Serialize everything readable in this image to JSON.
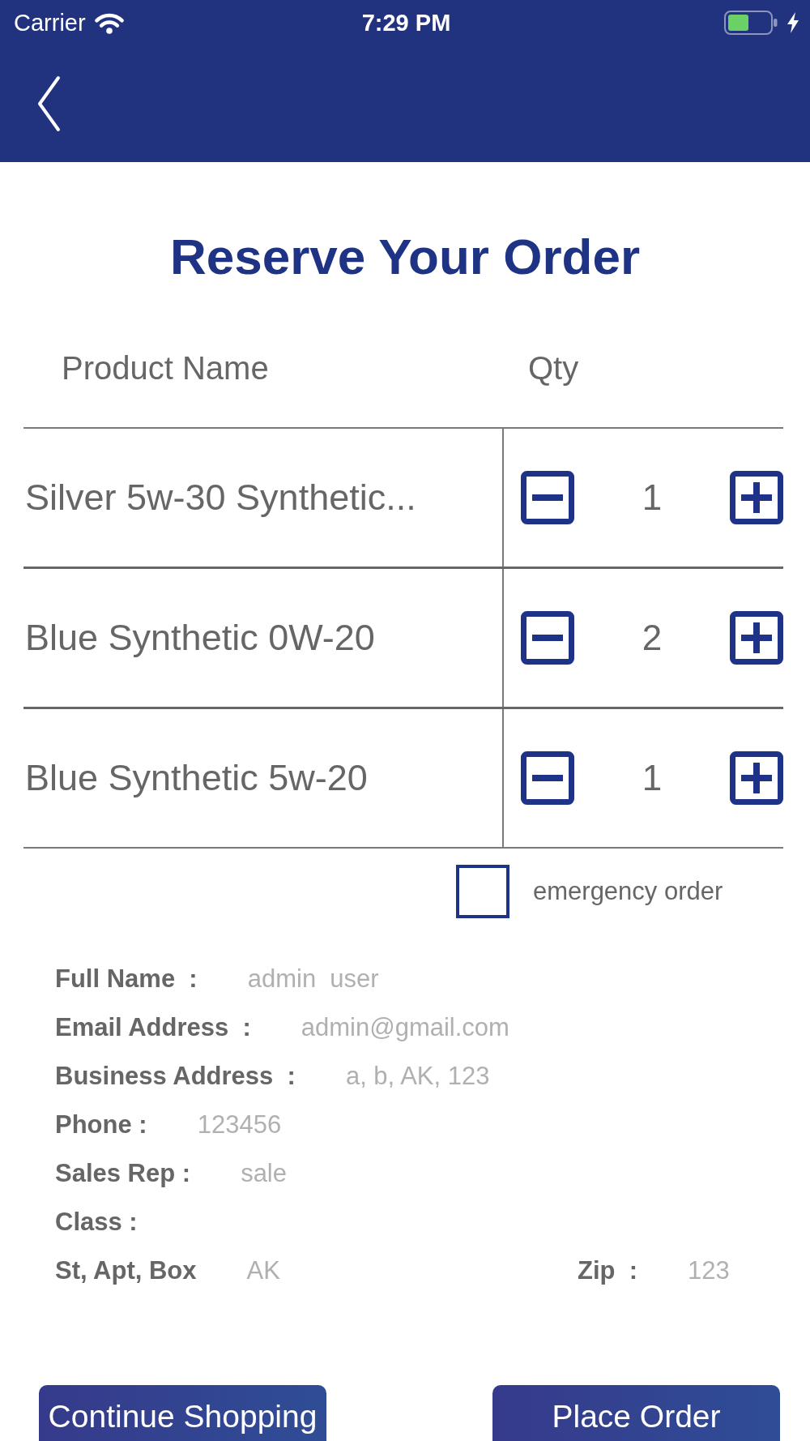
{
  "status_bar": {
    "carrier": "Carrier",
    "time": "7:29 PM"
  },
  "title": "Reserve Your Order",
  "table": {
    "columns": [
      "Product Name",
      "Qty"
    ],
    "rows": [
      {
        "product": "Silver 5w-30 Synthetic...",
        "qty": "1"
      },
      {
        "product": "Blue Synthetic 0W-20",
        "qty": "2"
      },
      {
        "product": "Blue Synthetic 5w-20",
        "qty": "1"
      }
    ]
  },
  "emergency_order": {
    "label": "emergency order",
    "checked": false
  },
  "customer_details": {
    "rows": [
      {
        "fields": [
          {
            "label": "Full Name  :",
            "value": "admin  user"
          }
        ]
      },
      {
        "fields": [
          {
            "label": "Email Address  :",
            "value": "admin@gmail.com"
          }
        ]
      },
      {
        "fields": [
          {
            "label": "Business Address  :",
            "value": "a, b, AK, 123"
          }
        ]
      },
      {
        "fields": [
          {
            "label": "Phone :",
            "value": "123456"
          }
        ]
      },
      {
        "fields": [
          {
            "label": "Sales Rep :",
            "value": "sale"
          }
        ]
      },
      {
        "fields": [
          {
            "label": "Class :"
          }
        ]
      },
      {
        "fields": [
          {
            "label": "St, Apt, Box",
            "value": "AK"
          },
          {
            "label": "Zip  :",
            "value": "123"
          }
        ]
      }
    ]
  },
  "buttons": [
    "Continue Shopping",
    "Place Order"
  ]
}
